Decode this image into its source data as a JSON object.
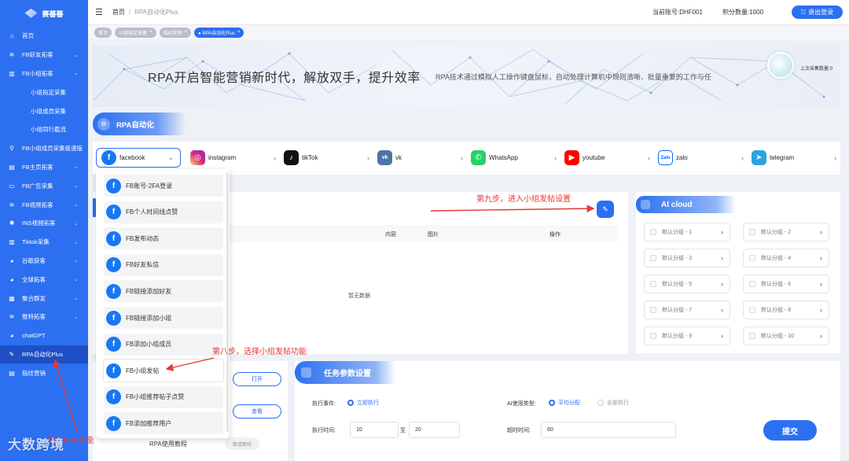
{
  "sidebar": {
    "logo": "赛蕃蕃",
    "items": [
      {
        "label": "首页",
        "icon": "home-icon",
        "glyph": "⌂"
      },
      {
        "label": "FB好友拓客",
        "icon": "layers-icon",
        "glyph": "≋",
        "chev": true
      },
      {
        "label": "FB小组拓客",
        "icon": "book-icon",
        "glyph": "▥",
        "chev": true
      },
      {
        "label": "小组指定采集",
        "sub": true
      },
      {
        "label": "小组成员采集",
        "sub": true
      },
      {
        "label": "小组同行截流",
        "sub": true
      },
      {
        "label": "FB小组成员采集极速版",
        "icon": "search-icon",
        "glyph": "⚲"
      },
      {
        "label": "FB主页拓客",
        "icon": "page-icon",
        "glyph": "▤",
        "chev": true
      },
      {
        "label": "FB广告采集",
        "icon": "chat-icon",
        "glyph": "▭",
        "chev": true
      },
      {
        "label": "FB视频拓客",
        "icon": "video-icon",
        "glyph": "≋",
        "chev": true
      },
      {
        "label": "INS视频拓客",
        "icon": "sun-icon",
        "glyph": "✺",
        "chev": true
      },
      {
        "label": "Tiktok采集",
        "icon": "book-icon",
        "glyph": "▥",
        "chev": true
      },
      {
        "label": "谷歌获客",
        "icon": "globe-icon",
        "glyph": "◕",
        "chev": true
      },
      {
        "label": "全球拓客",
        "icon": "globe-icon",
        "glyph": "◕",
        "chev": true
      },
      {
        "label": "聚合群发",
        "icon": "grid-icon",
        "glyph": "▦",
        "chev": true
      },
      {
        "label": "推特拓客",
        "icon": "layers-icon",
        "glyph": "≋",
        "chev": true
      },
      {
        "label": "chatGPT",
        "icon": "globe-icon",
        "glyph": "◕"
      },
      {
        "label": "RPA自动化Plus",
        "icon": "edit-icon",
        "glyph": "✎",
        "active": true
      },
      {
        "label": "指纹营销",
        "icon": "doc-icon",
        "glyph": "▤"
      }
    ]
  },
  "topbar": {
    "breadcrumb_home": "首页",
    "breadcrumb_current": "RPA自动化Plus",
    "account": "当前账号:DHF001",
    "points": "积分数量:1000",
    "logout": "退出登录"
  },
  "tabs": [
    {
      "label": "首页",
      "close": false
    },
    {
      "label": "小组指定采集",
      "close": true
    },
    {
      "label": "指纹营销",
      "close": true
    },
    {
      "label": "● RPA自动化Plus",
      "close": true,
      "active": true
    }
  ],
  "banner": {
    "title": "RPA开启智能营销新时代，解放双手，提升效率",
    "subtitle": "RPA技术通过模拟人工操作键盘鼠标，自动处理计算机中规则清晰、批量重复的工作与任",
    "last_collect": "上次采集数量:0"
  },
  "rpa_title": "RPA自动化",
  "platforms": [
    {
      "label": "facebook",
      "icon": "facebook-icon",
      "glyph": "f",
      "color": "#1877f2",
      "chev": "⌄"
    },
    {
      "label": "instagram",
      "icon": "instagram-icon",
      "glyph": "◎",
      "color": "#d6249f",
      "chev": "›"
    },
    {
      "label": "tikTok",
      "icon": "tiktok-icon",
      "glyph": "♪",
      "color": "#111111",
      "chev": "›"
    },
    {
      "label": "vk",
      "icon": "vk-icon",
      "glyph": "vk",
      "color": "#4c75a3",
      "chev": "›"
    },
    {
      "label": "WhatsApp",
      "icon": "whatsapp-icon",
      "glyph": "✆",
      "color": "#25d366",
      "chev": "›"
    },
    {
      "label": "youtube",
      "icon": "youtube-icon",
      "glyph": "▶",
      "color": "#ff0000",
      "chev": "›"
    },
    {
      "label": "zalo",
      "icon": "zalo-icon",
      "glyph": "Zalo",
      "color": "#ffffff",
      "chev": "›"
    },
    {
      "label": "telegram",
      "icon": "telegram-icon",
      "glyph": "➤",
      "color": "#2aa3df",
      "chev": "›"
    }
  ],
  "dropdown": [
    "FB账号-2FA登录",
    "FB个人时间线点赞",
    "FB发布动态",
    "FB好友私信",
    "FB链接添加好友",
    "FB链接添加小组",
    "FB添加小组成员",
    "FB小组发帖",
    "FB小组推荐帖子点赞",
    "FB添加推荐用户"
  ],
  "list": {
    "col_content": "内容",
    "col_image": "图片",
    "col_action": "操作",
    "empty": "暂无数据"
  },
  "annotations": {
    "step9": "第九步，进入小组发帖设置",
    "step8": "第八步，选择小组发帖功能",
    "bottom": "点击RPA功能"
  },
  "ai_cloud": {
    "title": "AI cloud",
    "groups": [
      "默认分组 - 1",
      "默认分组 - 2",
      "默认分组 - 3",
      "默认分组 - 4",
      "默认分组 - 5",
      "默认分组 - 6",
      "默认分组 - 7",
      "默认分组 - 8",
      "默认分组 - 9",
      "默认分组 - 10"
    ]
  },
  "bottom_left": {
    "open_btn": "打开",
    "view_btn": "查看",
    "tutorial": "RPA使用教程",
    "wait_btn": "敬请期待"
  },
  "task": {
    "title": "任务参数设置",
    "exec_event_label": "执行事件:",
    "exec_now": "立即执行",
    "ai_type_label": "AI使用类型:",
    "ai_avg": "平均分配",
    "ai_all": "全部执行",
    "exec_time_label": "执行时间:",
    "time_from": "10",
    "time_to_sep": "至",
    "time_to": "20",
    "timeout_label": "超时时间:",
    "timeout": "60",
    "submit": "提交"
  },
  "watermark": "大数跨境"
}
